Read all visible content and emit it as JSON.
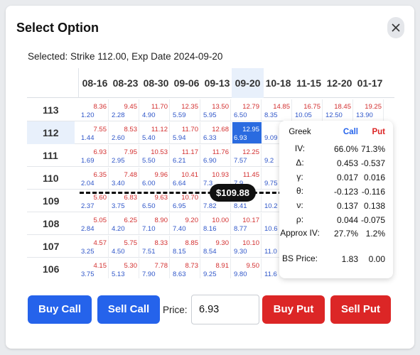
{
  "dialog": {
    "title": "Select Option",
    "close_icon": "close-icon"
  },
  "selected_text": "Selected: Strike 112.00, Exp Date 2024-09-20",
  "expiries": [
    "08-16",
    "08-23",
    "08-30",
    "09-06",
    "09-13",
    "09-20",
    "10-18",
    "11-15",
    "12-20",
    "01-17"
  ],
  "selected_expiry_index": 5,
  "selected_strike_index": 1,
  "rows": [
    {
      "strike": "113",
      "cells": [
        [
          "8.36",
          "1.20"
        ],
        [
          "9.45",
          "2.28"
        ],
        [
          "11.70",
          "4.90"
        ],
        [
          "12.35",
          "5.59"
        ],
        [
          "13.50",
          "5.95"
        ],
        [
          "12.79",
          "6.50"
        ],
        [
          "14.85",
          "8.35"
        ],
        [
          "16.75",
          "10.05"
        ],
        [
          "18.45",
          "12.50"
        ],
        [
          "19.25",
          "13.90"
        ]
      ]
    },
    {
      "strike": "112",
      "cells": [
        [
          "7.55",
          "1.44"
        ],
        [
          "8.53",
          "2.60"
        ],
        [
          "11.12",
          "5.40"
        ],
        [
          "11.70",
          "5.94"
        ],
        [
          "12.68",
          "6.33"
        ],
        [
          "12.95",
          "6.93"
        ],
        [
          "14.",
          "9.09"
        ],
        [
          "",
          ""
        ],
        [
          "",
          ""
        ],
        [
          "",
          ""
        ]
      ]
    },
    {
      "strike": "111",
      "cells": [
        [
          "6.93",
          "1.69"
        ],
        [
          "7.95",
          "2.95"
        ],
        [
          "10.53",
          "5.50"
        ],
        [
          "11.17",
          "6.21"
        ],
        [
          "11.76",
          "6.90"
        ],
        [
          "12.25",
          "7.57"
        ],
        [
          "",
          "9.2"
        ],
        [
          "",
          ""
        ],
        [
          "",
          ""
        ],
        [
          "",
          ""
        ]
      ]
    },
    {
      "strike": "110",
      "cells": [
        [
          "6.35",
          "2.04"
        ],
        [
          "7.48",
          "3.40"
        ],
        [
          "9.96",
          "6.00"
        ],
        [
          "10.41",
          "6.64"
        ],
        [
          "10.93",
          "7.3"
        ],
        [
          "11.45",
          "7.9"
        ],
        [
          "",
          "9.75"
        ],
        [
          "",
          ""
        ],
        [
          "",
          ""
        ],
        [
          "",
          ""
        ]
      ]
    },
    {
      "strike": "109",
      "cells": [
        [
          "5.60",
          "2.37"
        ],
        [
          "6.83",
          "3.75"
        ],
        [
          "9.63",
          "6.50"
        ],
        [
          "10.70",
          "6.95"
        ],
        [
          "",
          "7.82"
        ],
        [
          "",
          "8.41"
        ],
        [
          "",
          "10.2"
        ],
        [
          "",
          ""
        ],
        [
          "",
          ""
        ],
        [
          "",
          ""
        ]
      ]
    },
    {
      "strike": "108",
      "cells": [
        [
          "5.05",
          "2.84"
        ],
        [
          "6.25",
          "4.20"
        ],
        [
          "8.90",
          "7.10"
        ],
        [
          "9.20",
          "7.40"
        ],
        [
          "10.00",
          "8.16"
        ],
        [
          "10.17",
          "8.77"
        ],
        [
          "",
          "10.6"
        ],
        [
          "",
          ""
        ],
        [
          "",
          ""
        ],
        [
          "",
          ""
        ]
      ]
    },
    {
      "strike": "107",
      "cells": [
        [
          "4.57",
          "3.25"
        ],
        [
          "5.75",
          "4.50"
        ],
        [
          "8.33",
          "7.51"
        ],
        [
          "8.85",
          "8.15"
        ],
        [
          "9.30",
          "8.54"
        ],
        [
          "10.10",
          "9.30"
        ],
        [
          "",
          "11.0"
        ],
        [
          "",
          ""
        ],
        [
          "",
          ""
        ],
        [
          "",
          ""
        ]
      ]
    },
    {
      "strike": "106",
      "cells": [
        [
          "4.15",
          "3.75"
        ],
        [
          "5.30",
          "5.13"
        ],
        [
          "7.78",
          "7.90"
        ],
        [
          "8.73",
          "8.63"
        ],
        [
          "8.91",
          "9.25"
        ],
        [
          "9.50",
          "9.80"
        ],
        [
          "",
          "11.6"
        ],
        [
          "",
          ""
        ],
        [
          "",
          ""
        ],
        [
          "",
          ""
        ]
      ]
    }
  ],
  "price_line": {
    "label": "$109.88"
  },
  "greeks": {
    "header": {
      "name": "Greek",
      "call": "Call",
      "put": "Put",
      "call_color": "#2563eb",
      "put_color": "#dc2626"
    },
    "rows": [
      {
        "name": "IV:",
        "call": "66.0%",
        "put": "71.3%"
      },
      {
        "name": "Δ:",
        "call": "0.453",
        "put": "-0.537"
      },
      {
        "name": "γ:",
        "call": "0.017",
        "put": "0.016"
      },
      {
        "name": "θ:",
        "call": "-0.123",
        "put": "-0.116"
      },
      {
        "name": "ν:",
        "call": "0.137",
        "put": "0.138"
      },
      {
        "name": "ρ:",
        "call": "0.044",
        "put": "-0.075"
      },
      {
        "name": "Approx IV:",
        "call": "27.7%",
        "put": "1.2%"
      },
      {
        "name": "BS Price:",
        "call": "1.83",
        "put": "0.00"
      }
    ]
  },
  "actions": {
    "buy_call": "Buy Call",
    "sell_call": "Sell Call",
    "price_label": "Price:",
    "price_value": "6.93",
    "buy_put": "Buy Put",
    "sell_put": "Sell Put"
  },
  "colors": {
    "call_price": "#d32f2f",
    "put_price": "#2f56c9",
    "selected": "#2a6be0",
    "buy": "#2563eb",
    "sell": "#dc2626"
  }
}
